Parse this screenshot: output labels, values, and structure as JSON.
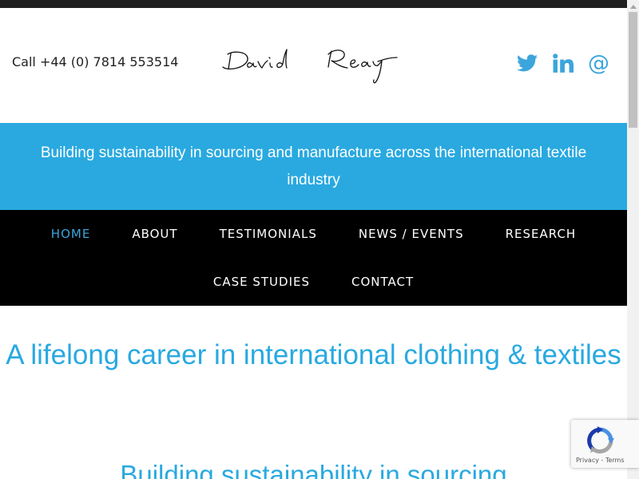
{
  "header": {
    "phone": "Call +44 (0) 7814 553514",
    "logo_alt": "David Reay",
    "social": [
      {
        "icon": "twitter-icon"
      },
      {
        "icon": "linkedin-icon"
      },
      {
        "icon": "email-at-icon",
        "glyph": "@"
      }
    ]
  },
  "tagline": "Building sustainability in sourcing and manufacture across the international textile industry",
  "nav": {
    "row1": [
      {
        "label": "HOME",
        "active": true
      },
      {
        "label": "ABOUT",
        "active": false
      },
      {
        "label": "TESTIMONIALS",
        "active": false
      },
      {
        "label": "NEWS / EVENTS",
        "active": false
      },
      {
        "label": "RESEARCH",
        "active": false
      }
    ],
    "row2": [
      {
        "label": "CASE STUDIES",
        "active": false
      },
      {
        "label": "CONTACT",
        "active": false
      }
    ]
  },
  "main": {
    "headline": "A lifelong career in international clothing & textiles",
    "subheadline": "Building sustainability in sourcing"
  },
  "recaptcha": {
    "privacy": "Privacy",
    "separator": " - ",
    "terms": "Terms"
  },
  "colors": {
    "accent": "#29a9e0",
    "nav_bg": "#000000",
    "topbar": "#1f1f1f"
  }
}
